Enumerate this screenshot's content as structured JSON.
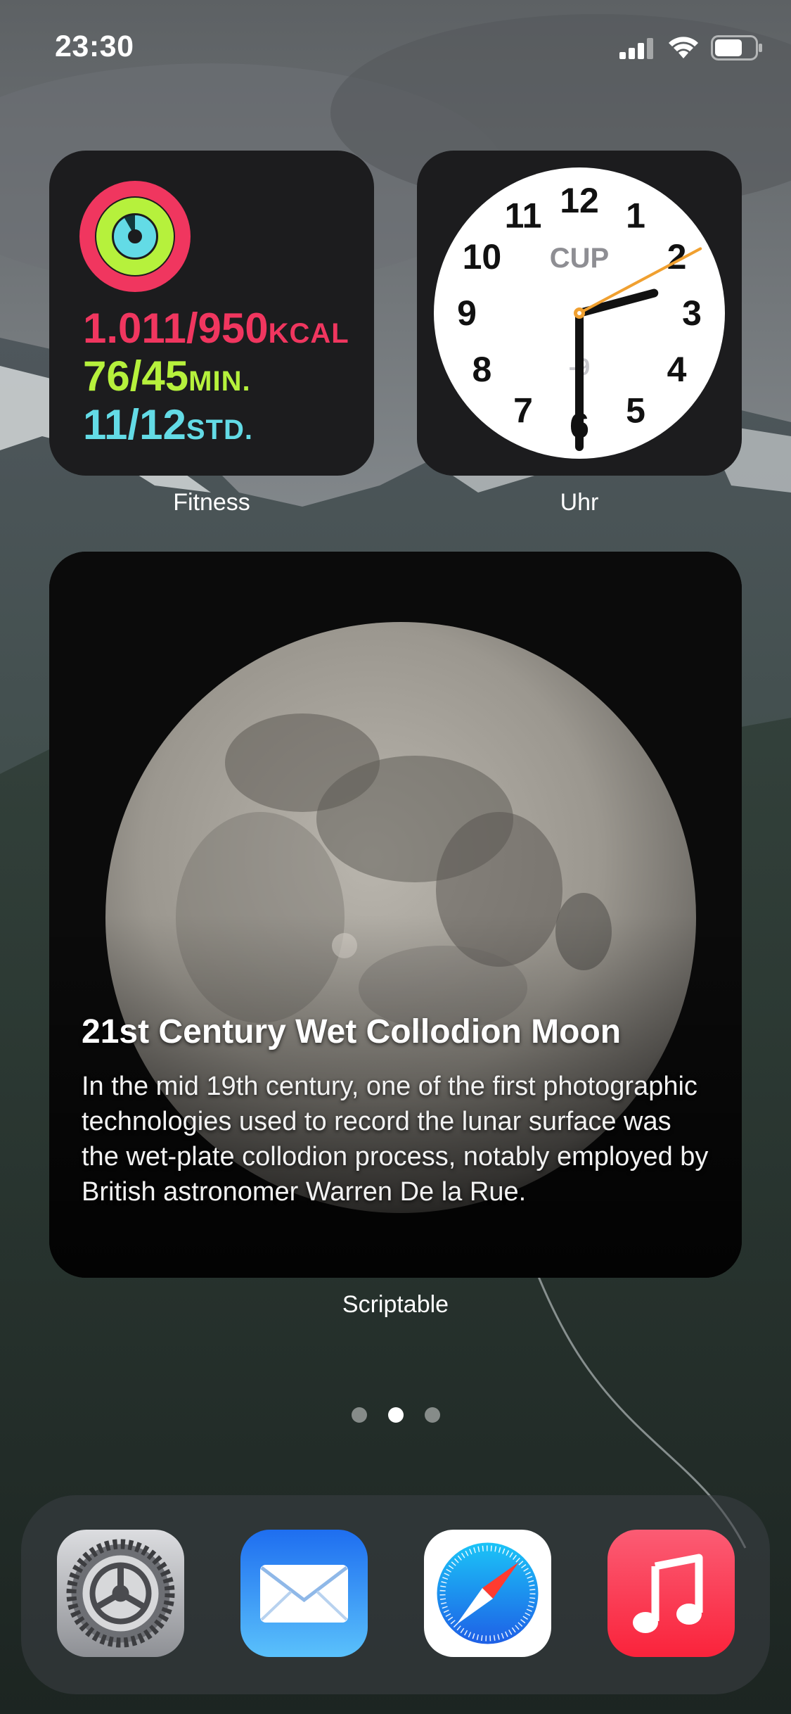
{
  "status_bar": {
    "time": "23:30"
  },
  "widgets": {
    "fitness": {
      "caption": "Fitness",
      "move": {
        "value": "1.011/950",
        "unit": "KCAL"
      },
      "exercise": {
        "value": "76/45",
        "unit": "MIN."
      },
      "stand": {
        "value": "11/12",
        "unit": "STD."
      },
      "colors": {
        "move": "#f0365f",
        "exercise": "#b6f13c",
        "stand": "#63dbe6"
      }
    },
    "clock": {
      "caption": "Uhr",
      "city": "CUP",
      "utc_offset": "-9",
      "numerals": [
        "12",
        "1",
        "2",
        "3",
        "4",
        "5",
        "6",
        "7",
        "8",
        "9",
        "10",
        "11"
      ],
      "time_shown": "2:30"
    },
    "scriptable": {
      "caption": "Scriptable",
      "title": "21st Century Wet Collodion Moon",
      "description": "In the mid 19th century, one of the first photographic technologies used to record the lunar surface was the wet-plate collodion process, notably employed by British astronomer Warren De la Rue."
    }
  },
  "page_indicator": {
    "count": 3,
    "active": 2
  },
  "dock": {
    "apps": [
      {
        "name": "settings",
        "icon": "gear-icon"
      },
      {
        "name": "mail",
        "icon": "envelope-icon"
      },
      {
        "name": "safari",
        "icon": "compass-icon"
      },
      {
        "name": "music",
        "icon": "music-note-icon"
      }
    ]
  }
}
